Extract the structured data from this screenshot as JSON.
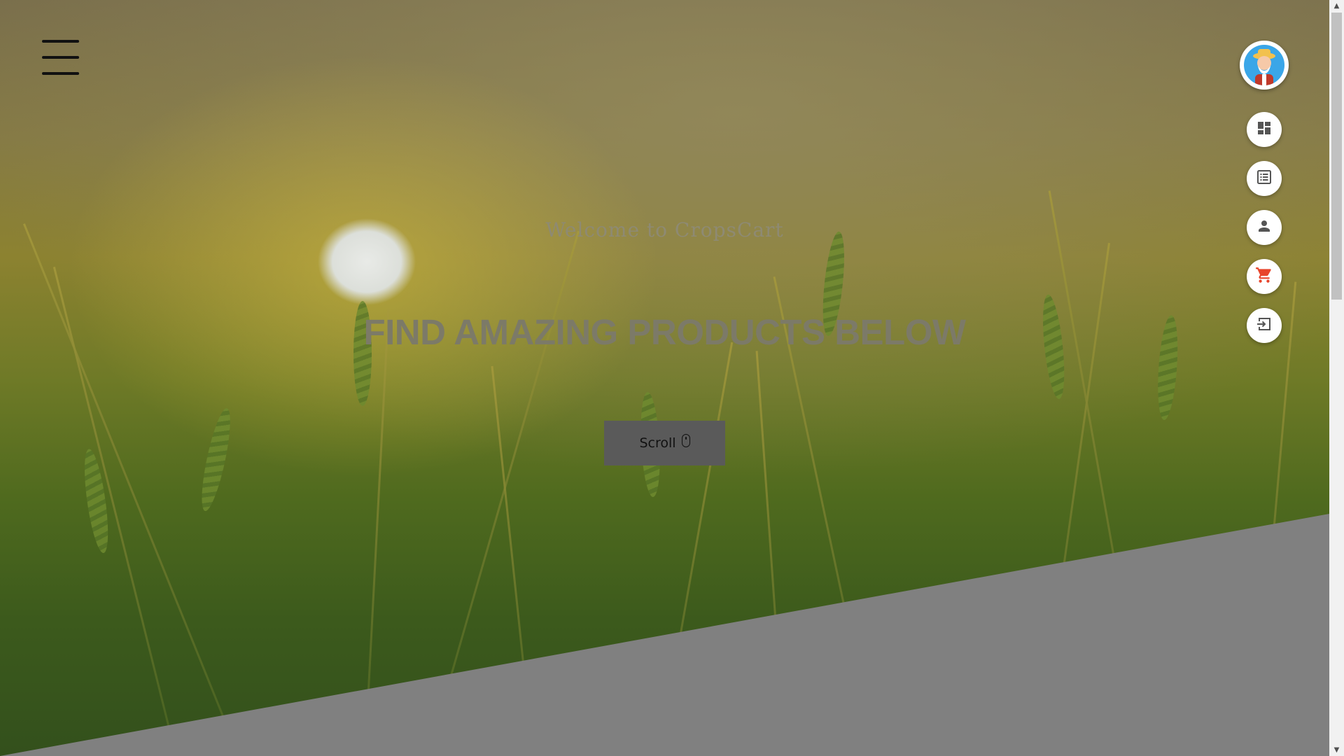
{
  "hero": {
    "welcome": "Welcome to CropsCart",
    "headline": "FIND AMAZING PRODUCTS BELOW",
    "scroll_label": "Scroll"
  },
  "nav": {
    "menu_icon": "hamburger-menu-icon",
    "avatar_icon": "farmer-avatar-icon",
    "actions": [
      {
        "icon": "dashboard-icon"
      },
      {
        "icon": "orders-list-icon"
      },
      {
        "icon": "person-icon"
      },
      {
        "icon": "cart-icon",
        "color": "#e8452c"
      },
      {
        "icon": "exit-icon"
      }
    ]
  },
  "colors": {
    "diagonal_panel": "#808080",
    "scroll_button_bg": "#5a5a5a"
  }
}
